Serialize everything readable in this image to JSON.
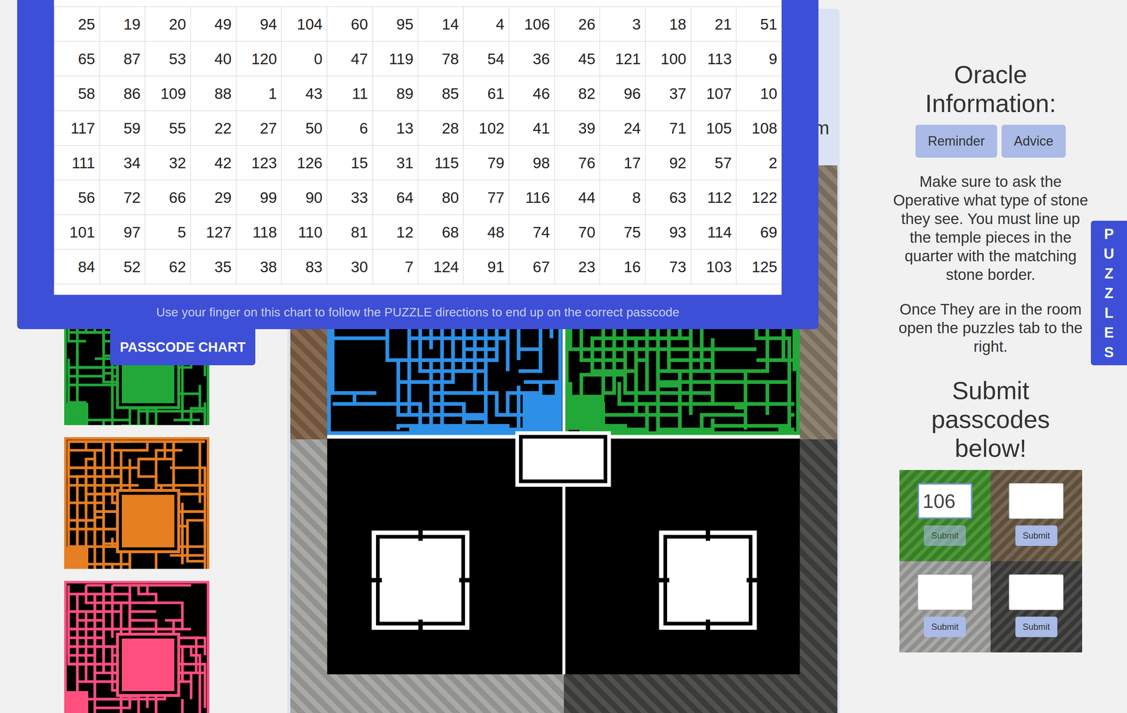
{
  "passcode_chart": {
    "rows": [
      [
        "25",
        "19",
        "20",
        "49",
        "94",
        "104",
        "60",
        "95",
        "14",
        "4",
        "106",
        "26",
        "3",
        "18",
        "21",
        "51"
      ],
      [
        "65",
        "87",
        "53",
        "40",
        "120",
        "0",
        "47",
        "119",
        "78",
        "54",
        "36",
        "45",
        "121",
        "100",
        "113",
        "9"
      ],
      [
        "58",
        "86",
        "109",
        "88",
        "1",
        "43",
        "11",
        "89",
        "85",
        "61",
        "46",
        "82",
        "96",
        "37",
        "107",
        "10"
      ],
      [
        "117",
        "59",
        "55",
        "22",
        "27",
        "50",
        "6",
        "13",
        "28",
        "102",
        "41",
        "39",
        "24",
        "71",
        "105",
        "108"
      ],
      [
        "111",
        "34",
        "32",
        "42",
        "123",
        "126",
        "15",
        "31",
        "115",
        "79",
        "98",
        "76",
        "17",
        "92",
        "57",
        "2"
      ],
      [
        "56",
        "72",
        "66",
        "29",
        "99",
        "90",
        "33",
        "64",
        "80",
        "77",
        "116",
        "44",
        "8",
        "63",
        "112",
        "122"
      ],
      [
        "101",
        "97",
        "5",
        "127",
        "118",
        "110",
        "81",
        "12",
        "68",
        "48",
        "74",
        "70",
        "75",
        "93",
        "114",
        "69"
      ],
      [
        "84",
        "52",
        "62",
        "35",
        "38",
        "83",
        "30",
        "7",
        "124",
        "91",
        "67",
        "23",
        "16",
        "73",
        "103",
        "125"
      ]
    ],
    "footer": "Use your finger on this chart to follow the PUZZLE directions to end up on the correct passcode",
    "tab_label": "PASSCODE CHART"
  },
  "header": {
    "title_fragment": "m"
  },
  "thumbnails": [
    {
      "color": "#22a838"
    },
    {
      "color": "#e67e22"
    },
    {
      "color": "#ff4f7f"
    }
  ],
  "board": {
    "border_colors": [
      "#7d5e43",
      "#857866",
      "#a2a29f",
      "#42423f"
    ],
    "mazes": [
      {
        "color": "#2d8fe6"
      },
      {
        "color": "#22a838"
      }
    ],
    "pieces": [
      {
        "color": "#2d8fe6"
      },
      {
        "color": "#22a838"
      }
    ]
  },
  "oracle": {
    "title": "Oracle Information:",
    "buttons": [
      {
        "label": "Reminder"
      },
      {
        "label": "Advice"
      }
    ],
    "paragraphs": [
      "Make sure to ask the Operative what type of stone they see. You must line up the temple pieces in the quarter with the matching stone border.",
      "Once They are in the room open the puzzles tab to the right."
    ],
    "submit_title": "Submit passcodes below!",
    "tiles": [
      {
        "color": "#3f8f2a",
        "value": "106",
        "button": "Submit",
        "focused": true,
        "disabled": true
      },
      {
        "color": "#6b5a45",
        "value": "",
        "button": "Submit",
        "focused": false,
        "disabled": false
      },
      {
        "color": "#a2a3a0",
        "value": "",
        "button": "Submit",
        "focused": false,
        "disabled": false
      },
      {
        "color": "#3e3e3c",
        "value": "",
        "button": "Submit",
        "focused": false,
        "disabled": false
      }
    ]
  },
  "puzzles_tab": {
    "label": "PUZZLES"
  }
}
